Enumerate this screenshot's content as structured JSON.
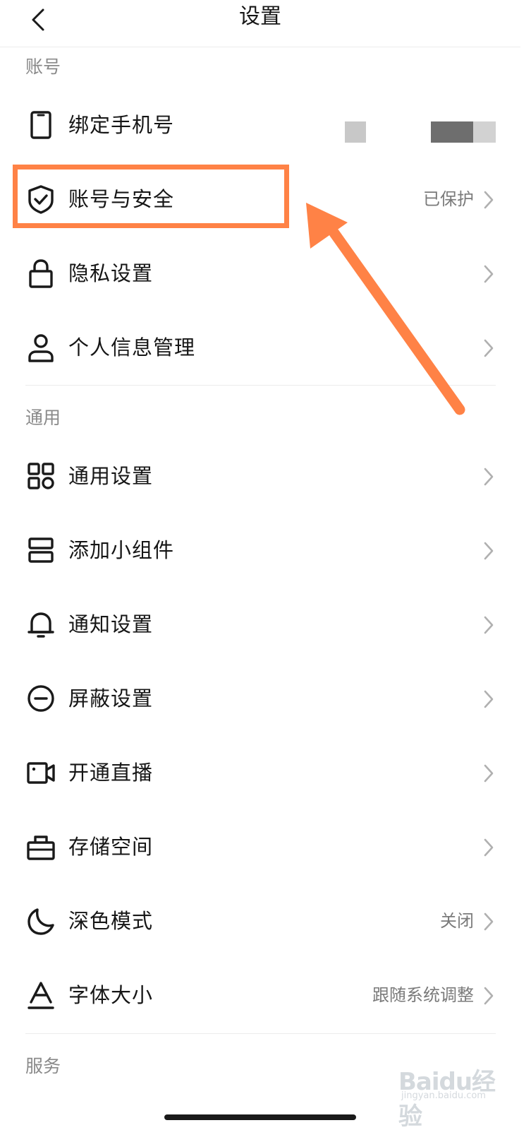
{
  "header": {
    "title": "设置",
    "back_icon": "back-chevron-icon"
  },
  "sections": {
    "account": "账号",
    "general": "通用",
    "service": "服务"
  },
  "account_rows": {
    "phone": {
      "label": "绑定手机号",
      "icon": "phone-icon"
    },
    "security": {
      "label": "账号与安全",
      "value": "已保护",
      "icon": "shield-check-icon"
    },
    "privacy": {
      "label": "隐私设置",
      "icon": "lock-icon"
    },
    "personal": {
      "label": "个人信息管理",
      "icon": "user-icon"
    }
  },
  "general_rows": {
    "general_settings": {
      "label": "通用设置",
      "icon": "grid-icon"
    },
    "widget": {
      "label": "添加小组件",
      "icon": "widget-icon"
    },
    "notification": {
      "label": "通知设置",
      "icon": "bell-icon"
    },
    "block": {
      "label": "屏蔽设置",
      "icon": "block-icon"
    },
    "live": {
      "label": "开通直播",
      "icon": "video-camera-icon"
    },
    "storage": {
      "label": "存储空间",
      "icon": "storage-box-icon"
    },
    "dark_mode": {
      "label": "深色模式",
      "value": "关闭",
      "icon": "moon-icon"
    },
    "font_size": {
      "label": "字体大小",
      "value": "跟随系统调整",
      "icon": "font-size-icon"
    }
  },
  "colors": {
    "highlight": "#ff8246",
    "text": "#161616",
    "muted": "#7a7a7a"
  },
  "watermark": {
    "logo": "Baidu经验",
    "sub": "jingyan.baidu.com"
  }
}
